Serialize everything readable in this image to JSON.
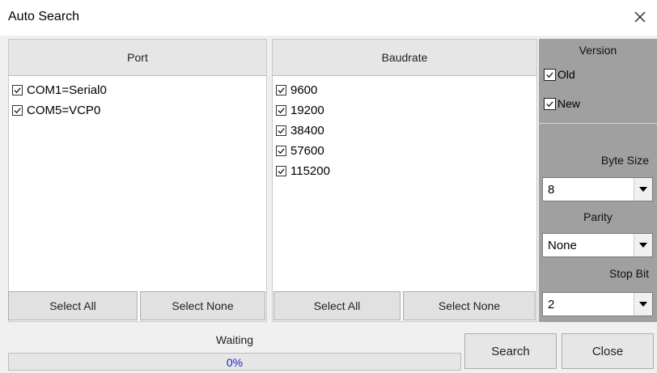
{
  "window": {
    "title": "Auto Search",
    "close_icon": "close-icon"
  },
  "port_panel": {
    "header": "Port",
    "items": [
      {
        "label": "COM1=Serial0",
        "checked": true
      },
      {
        "label": "COM5=VCP0",
        "checked": true
      }
    ],
    "select_all": "Select All",
    "select_none": "Select None"
  },
  "baud_panel": {
    "header": "Baudrate",
    "items": [
      {
        "label": "9600",
        "checked": true
      },
      {
        "label": "19200",
        "checked": true
      },
      {
        "label": "38400",
        "checked": true
      },
      {
        "label": "57600",
        "checked": true
      },
      {
        "label": "115200",
        "checked": true
      }
    ],
    "select_all": "Select All",
    "select_none": "Select None"
  },
  "settings": {
    "version_label": "Version",
    "old_label": "Old",
    "old_checked": true,
    "new_label": "New",
    "new_checked": true,
    "byte_size_label": "Byte Size",
    "byte_size_value": "8",
    "parity_label": "Parity",
    "parity_value": "None",
    "stop_bit_label": "Stop Bit",
    "stop_bit_value": "2"
  },
  "status": {
    "text": "Waiting",
    "progress_percent": 0,
    "progress_text": "0%"
  },
  "buttons": {
    "search": "Search",
    "close": "Close"
  },
  "colors": {
    "right_panel_bg": "#a0a0a0",
    "progress_text": "#1a1ac8"
  }
}
